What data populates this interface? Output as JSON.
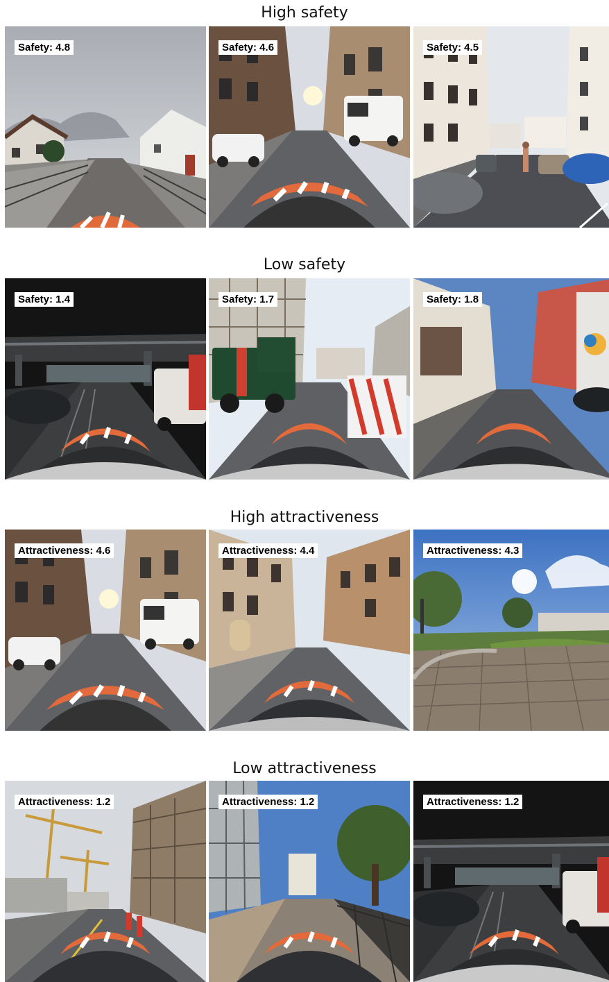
{
  "sections": [
    {
      "title": "High safety",
      "images": [
        {
          "label": "Safety: 4.8",
          "scene": "suburban-street"
        },
        {
          "label": "Safety: 4.6",
          "scene": "city-street-vans"
        },
        {
          "label": "Safety: 4.5",
          "scene": "residential-street-pedestrian"
        }
      ]
    },
    {
      "title": "Low safety",
      "images": [
        {
          "label": "Safety: 1.4",
          "scene": "underpass"
        },
        {
          "label": "Safety: 1.7",
          "scene": "construction-truck"
        },
        {
          "label": "Safety: 1.8",
          "scene": "narrow-street-graffiti"
        }
      ]
    },
    {
      "title": "High attractiveness",
      "images": [
        {
          "label": "Attractiveness: 4.6",
          "scene": "city-street-vans"
        },
        {
          "label": "Attractiveness: 4.4",
          "scene": "historic-boulevard"
        },
        {
          "label": "Attractiveness: 4.3",
          "scene": "cobblestone-square"
        }
      ]
    },
    {
      "title": "Low attractiveness",
      "images": [
        {
          "label": "Attractiveness: 1.2",
          "scene": "construction-cranes"
        },
        {
          "label": "Attractiveness: 1.2",
          "scene": "dirt-construction-road"
        },
        {
          "label": "Attractiveness: 1.2",
          "scene": "underpass"
        }
      ]
    }
  ]
}
